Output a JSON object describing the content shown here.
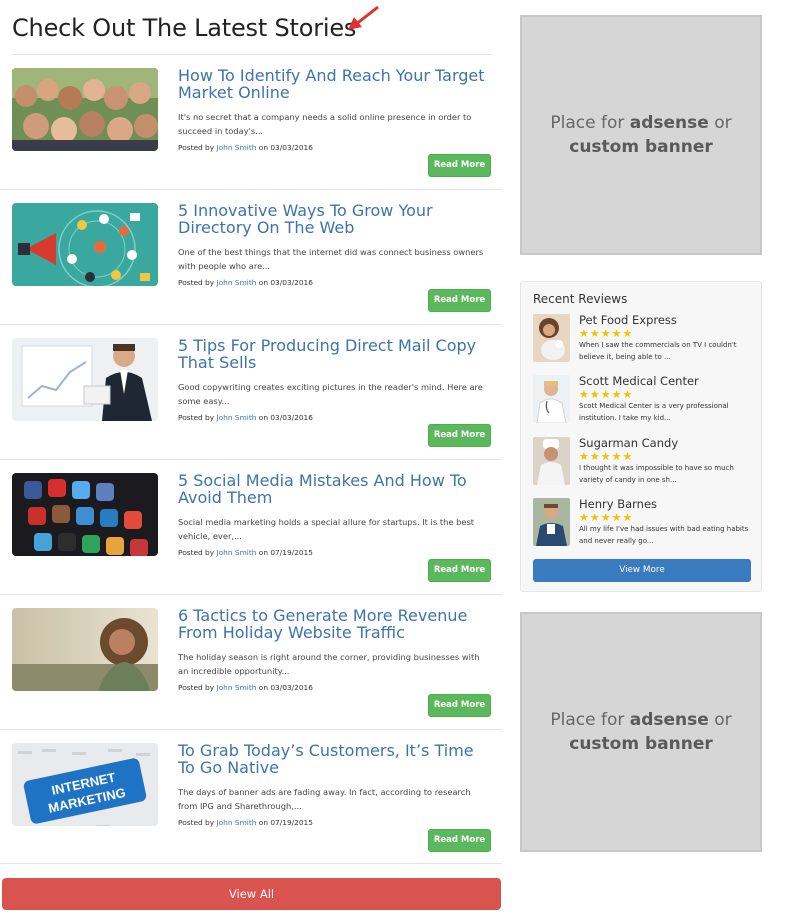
{
  "heading": "Check Out The Latest Stories",
  "stories": [
    {
      "title": "How To Identify And Reach Your Target Market Online",
      "excerpt": "It's no secret that a company needs a solid online presence in order to succeed in today's...",
      "posted_by": "Posted by",
      "author": "John Smith",
      "date": "on 03/03/2016",
      "button": "Read More"
    },
    {
      "title": "5 Innovative Ways To Grow Your Directory On The Web",
      "excerpt": "One of the best things that the internet did was connect business owners with people who are...",
      "posted_by": "Posted by",
      "author": "John Smith",
      "date": "on 03/03/2016",
      "button": "Read More"
    },
    {
      "title": "5 Tips For Producing Direct Mail Copy That Sells",
      "excerpt": "Good copywriting creates exciting pictures in the reader's mind. Here are some easy...",
      "posted_by": "Posted by",
      "author": "John Smith",
      "date": "on 03/03/2016",
      "button": "Read More"
    },
    {
      "title": "5 Social Media Mistakes And How To Avoid Them",
      "excerpt": "Social media marketing holds a special allure for startups. It is the best vehicle, ever,...",
      "posted_by": "Posted by",
      "author": "John Smith",
      "date": "on 07/19/2015",
      "button": "Read More"
    },
    {
      "title": "6 Tactics to Generate More Revenue From Holiday Website Traffic",
      "excerpt": "The holiday season is right around the corner, providing businesses with an incredible opportunity...",
      "posted_by": "Posted by",
      "author": "John Smith",
      "date": "on 03/03/2016",
      "button": "Read More"
    },
    {
      "title": "To Grab Today’s Customers, It’s Time To Go Native",
      "excerpt": "The days of banner ads are fading away. In fact, according to research from IPG and Sharethrough,...",
      "posted_by": "Posted by",
      "author": "John Smith",
      "date": "on 07/19/2015",
      "button": "Read More"
    }
  ],
  "thumb_text": {
    "internet_marketing_line1": "INTERNET",
    "internet_marketing_line2": "MARKETING"
  },
  "view_all": "View All",
  "ad": {
    "prefix": "Place for",
    "strong1": "adsense",
    "mid": "or",
    "strong2": "custom banner"
  },
  "reviews": {
    "title": "Recent Reviews",
    "items": [
      {
        "name": "Pet Food Express",
        "stars": "★★★★★",
        "text": "When I saw the commercials on TV I couldn't believe it, being able to ..."
      },
      {
        "name": "Scott Medical Center",
        "stars": "★★★★★",
        "text": "Scott Medical Center is a very professional institution. I take my kid..."
      },
      {
        "name": "Sugarman Candy",
        "stars": "★★★★★",
        "text": "I thought it was impossible to have so much variety of candy in one sh..."
      },
      {
        "name": "Henry Barnes",
        "stars": "★★★★★",
        "text": "All my life I've had issues with bad eating habits and never really go..."
      }
    ],
    "button": "View More"
  },
  "colors": {
    "link": "#3d73b0",
    "read_more": "#5cb85c",
    "view_all": "#d9534f",
    "view_more": "#3a7bbf",
    "star": "#f2c200",
    "arrow": "#e03030"
  }
}
